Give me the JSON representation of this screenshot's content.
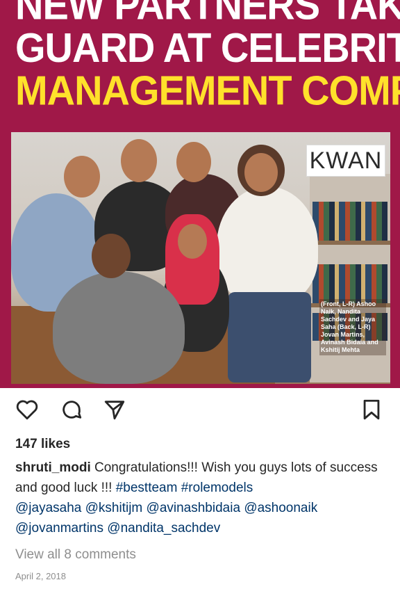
{
  "post_image": {
    "headline": {
      "line1": "NEW PARTNERS TAKE FRESH",
      "line2": "GUARD AT CELEBRITY",
      "line3": "MANAGEMENT COMPANY"
    },
    "logo_text": "KWAN",
    "photo_caption": "(Front, L-R) Ashoo Naik, Nandita Sachdev and Jaya Saha (Back, L-R) Jovan Martins, Avinash Bidaia and Kshitij Mehta"
  },
  "actions": {
    "like_icon": "heart-icon",
    "comment_icon": "comment-bubble-icon",
    "share_icon": "paper-plane-icon",
    "save_icon": "bookmark-icon"
  },
  "likes_text": "147 likes",
  "comment": {
    "username": "shruti_modi",
    "text_part1": " Congratulations!!! Wish you guys lots of success and good luck !!! ",
    "hashtags": [
      "#bestteam",
      "#rolemodels"
    ],
    "mentions": [
      "@jayasaha",
      "@kshitijm",
      "@avinashbidaia",
      "@ashoonaik",
      "@jovanmartins",
      "@nandita_sachdev"
    ]
  },
  "view_all_comments": "View all 8 comments",
  "date": "April 2, 2018",
  "colors": {
    "headline_bg": "#a01848",
    "headline_yellow": "#ffe12b",
    "link_blue": "#003569",
    "muted_gray": "#8e8e8e"
  }
}
